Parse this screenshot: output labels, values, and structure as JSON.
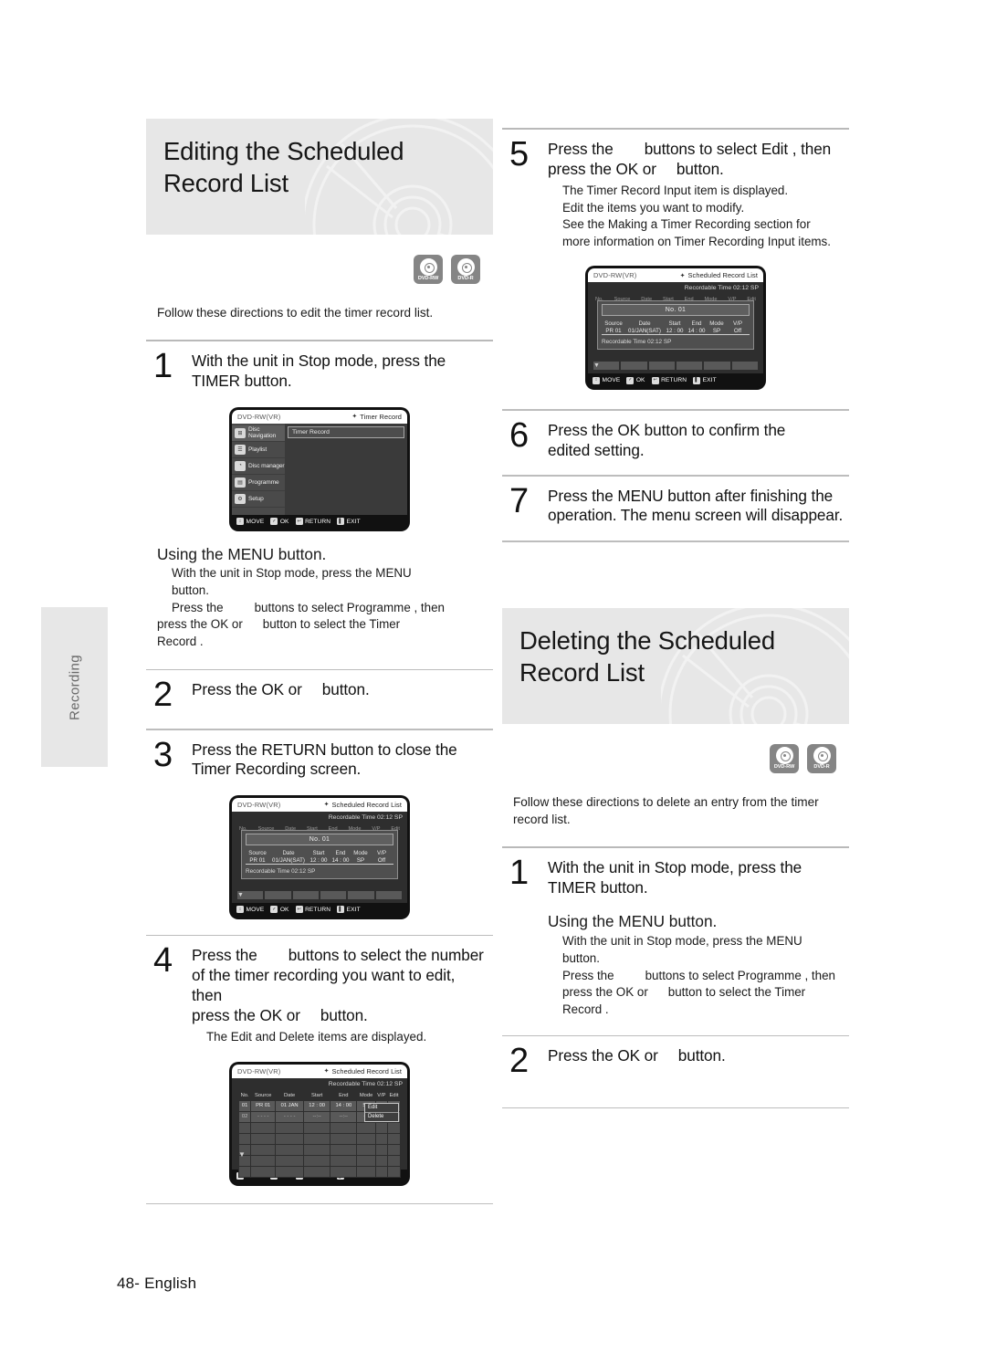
{
  "page": {
    "footer": "48- English",
    "side_tab": "Recording"
  },
  "left": {
    "banner_title_line1": "Editing the Scheduled",
    "banner_title_line2": "Record List",
    "logos": [
      {
        "name": "dvd-rw-logo",
        "label": "DVD-RW"
      },
      {
        "name": "dvd-r-logo",
        "label": "DVD-R"
      }
    ],
    "intro": "Follow these directions to edit the timer record list.",
    "step1": {
      "num": "1",
      "line1": "With the unit in Stop mode, press the",
      "line2": "TIMER button."
    },
    "menu_section": {
      "heading": "Using the MENU button.",
      "l1": "With the unit in Stop mode, press the MENU",
      "l2": "button.",
      "l3a": "Press the",
      "l3b": "buttons to select Programme , then",
      "l4a": "press the OK or",
      "l4b": "button to select the Timer",
      "l5": "Record ."
    },
    "step2": {
      "num": "2",
      "a": "Press the OK or",
      "b": "button."
    },
    "step3": {
      "num": "3",
      "line1": "Press the RETURN button to close the",
      "line2": "Timer Recording screen."
    },
    "step4": {
      "num": "4",
      "l1a": "Press the",
      "l1b": "buttons to select the number",
      "l2": "of the timer recording you want to edit, then",
      "l3a": "press the OK or",
      "l3b": "button.",
      "sub": "The Edit and Delete items are displayed."
    }
  },
  "right": {
    "step5": {
      "num": "5",
      "l1a": "Press the",
      "l1b": "buttons to select Edit , then",
      "l2a": "press the OK or",
      "l2b": "button.",
      "s1": "The Timer Record Input item is displayed.",
      "s2": "Edit the items you want to modify.",
      "s3": "See the  Making a Timer Recording  section for",
      "s4": "more information on Timer Recording Input items."
    },
    "step6": {
      "num": "6",
      "line1": "Press the OK button to confirm the",
      "line2": "edited setting."
    },
    "step7": {
      "num": "7",
      "line1": "Press the MENU button after finishing the",
      "line2": "operation. The menu screen will disappear."
    },
    "banner_title_line1": "Deleting the Scheduled",
    "banner_title_line2": "Record List",
    "logos": [
      {
        "name": "dvd-rw-logo",
        "label": "DVD-RW"
      },
      {
        "name": "dvd-r-logo",
        "label": "DVD-R"
      }
    ],
    "intro_l1": "Follow these directions to delete an entry from the timer",
    "intro_l2": "record list.",
    "step1": {
      "num": "1",
      "line1": "With the unit in Stop mode, press the",
      "line2": "TIMER button."
    },
    "menu_section": {
      "heading": "Using the MENU button.",
      "l1": "With the unit in Stop mode, press the MENU",
      "l2": "button.",
      "l3a": "Press the",
      "l3b": "buttons to select Programme , then",
      "l4a": "press the OK or",
      "l4b": "button to select the Timer",
      "l5": "Record ."
    },
    "step2": {
      "num": "2",
      "a": "Press the OK or",
      "b": "button."
    }
  },
  "screens": {
    "nav_bar": [
      {
        "icon": "move-icon",
        "glyph": "↕",
        "label": "MOVE"
      },
      {
        "icon": "ok-icon",
        "glyph": "✓",
        "label": "OK"
      },
      {
        "icon": "return-icon",
        "glyph": "↩",
        "label": "RETURN"
      },
      {
        "icon": "exit-icon",
        "glyph": "❙",
        "label": "EXIT"
      }
    ],
    "menu_screen": {
      "disc_type": "DVD-RW(VR)",
      "title": "Timer Record",
      "sidebar": [
        {
          "label": "Disc Navigation",
          "icon": "disc-navigation-icon",
          "glyph": "⊞"
        },
        {
          "label": "Playlist",
          "icon": "playlist-icon",
          "glyph": "☰"
        },
        {
          "label": "Disc manager",
          "icon": "disc-manager-icon",
          "glyph": "◔"
        },
        {
          "label": "Programme",
          "icon": "programme-icon",
          "glyph": "▤"
        },
        {
          "label": "Setup",
          "icon": "setup-gear-icon",
          "glyph": "⚙"
        }
      ],
      "selected_item": "Timer Record"
    },
    "input_screen": {
      "disc_type": "DVD-RW(VR)",
      "title": "Scheduled Record List",
      "recordable_time": "Recordable Time 02:12 SP",
      "ghost_headers": [
        "No.",
        "Source",
        "Date",
        "Start",
        "End",
        "Mode",
        "V/P",
        "Edit"
      ],
      "dialog_title": "No. 01",
      "field_headers": [
        "Source",
        "Date",
        "Start",
        "End",
        "Mode",
        "V/P"
      ],
      "field_values": [
        "PR 01",
        "01/JAN(SAT)",
        "12 : 00",
        "14 : 00",
        "SP",
        "Off"
      ],
      "dialog_footer": "Recordable Time 02:12 SP"
    },
    "list_screen": {
      "disc_type": "DVD-RW(VR)",
      "title": "Scheduled Record List",
      "recordable_time": "Recordable Time 02:12 SP",
      "headers": [
        "No.",
        "Source",
        "Date",
        "Start",
        "End",
        "Mode",
        "V/P",
        "Edit"
      ],
      "rows": [
        [
          "01",
          "PR 01",
          "01 JAN",
          "12 : 00",
          "14 : 00",
          "SP",
          "",
          ""
        ],
        [
          "02",
          "- - - -",
          "- - - -",
          "--:--",
          "--:--",
          "- -",
          "",
          ""
        ]
      ],
      "popup": [
        "Edit",
        "Delete"
      ]
    }
  }
}
